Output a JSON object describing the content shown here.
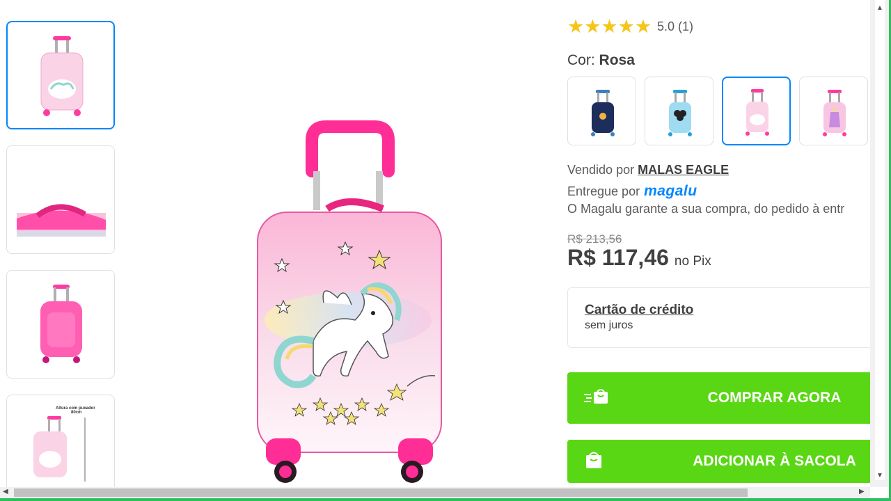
{
  "gallery": {
    "thumbnails": [
      {
        "name": "thumb-front",
        "active": true
      },
      {
        "name": "thumb-handle",
        "active": false
      },
      {
        "name": "thumb-back",
        "active": false
      },
      {
        "name": "thumb-dimensions",
        "active": false,
        "caption_line1": "Altura com puxador",
        "caption_line2": "80cm"
      }
    ]
  },
  "rating": {
    "stars": "★★★★★",
    "text": "5.0 (1)",
    "star_color": "#f5c518"
  },
  "color": {
    "label": "Cor:",
    "selected": "Rosa"
  },
  "variants": [
    {
      "name": "navy-space",
      "active": false
    },
    {
      "name": "light-blue-mouse",
      "active": false
    },
    {
      "name": "pink-unicorn",
      "active": true
    },
    {
      "name": "pink-princess",
      "active": false
    }
  ],
  "seller": {
    "prefix": "Vendido por",
    "name": "MALAS EAGLE",
    "delivered_prefix": "Entregue por",
    "delivered_by": "magalu",
    "guarantee": "O Magalu garante a sua compra, do pedido à entr"
  },
  "price": {
    "old": "R$ 213,56",
    "current": "R$ 117,46",
    "note": "no Pix"
  },
  "payment": {
    "title": "Cartão de crédito",
    "subtitle": "sem juros"
  },
  "actions": {
    "buy_now": "COMPRAR AGORA",
    "add_to_bag": "ADICIONAR À SACOLA",
    "button_color": "#5ad714"
  },
  "colors": {
    "accent": "#0086ff",
    "text": "#404040"
  }
}
